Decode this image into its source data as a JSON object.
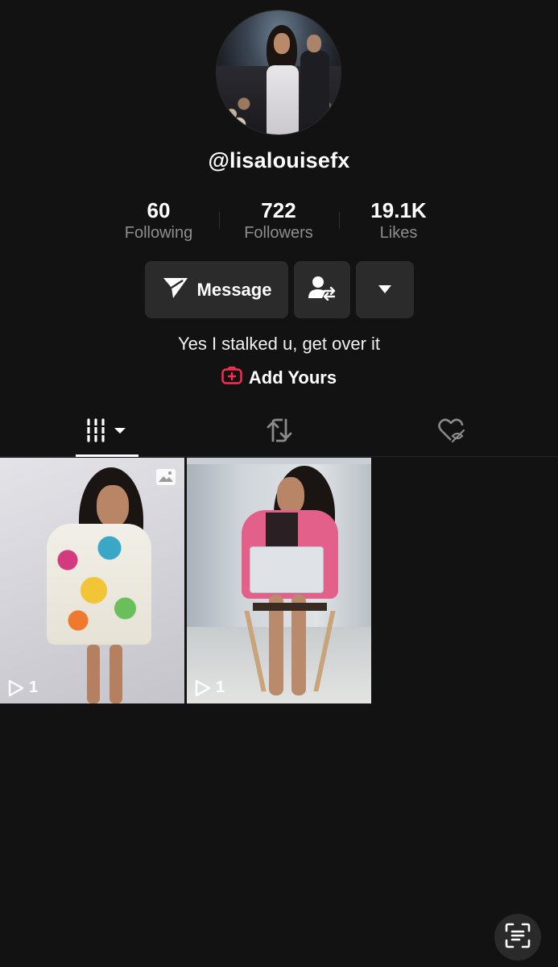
{
  "profile": {
    "username": "@lisalouisefx",
    "bio": "Yes I stalked u, get over it"
  },
  "stats": [
    {
      "value": "60",
      "label": "Following"
    },
    {
      "value": "722",
      "label": "Followers"
    },
    {
      "value": "19.1K",
      "label": "Likes"
    }
  ],
  "actions": {
    "message_label": "Message",
    "add_yours_label": "Add Yours"
  },
  "colors": {
    "background": "#121212",
    "button": "#2b2b2b",
    "add_yours_accent": "#fe2c55",
    "muted_text": "#8d8d8d"
  },
  "tabs": [
    {
      "icon": "videos-grid-icon",
      "selected": true
    },
    {
      "icon": "reposts-icon",
      "selected": false
    },
    {
      "icon": "liked-hidden-icon",
      "selected": false
    }
  ],
  "videos": [
    {
      "views": "1",
      "type": "photo"
    },
    {
      "views": "1",
      "type": "video"
    }
  ]
}
